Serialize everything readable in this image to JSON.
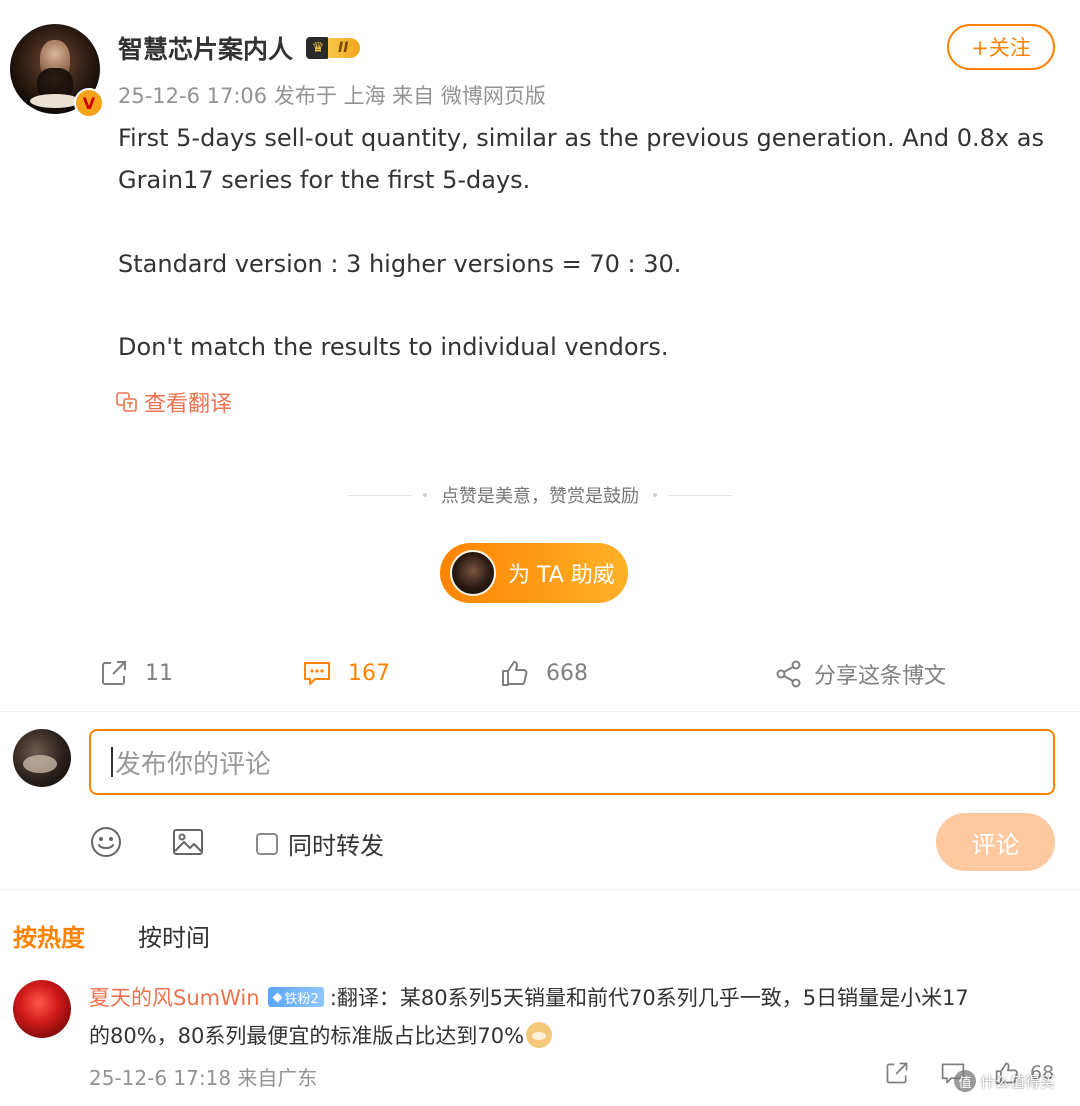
{
  "post": {
    "author": "智慧芯片案内人",
    "level_badge": "II",
    "verified_mark": "V",
    "meta": "25-12-6 17:06 发布于 上海  来自 微博网页版",
    "follow_label": "+关注",
    "lines": [
      "First 5-days sell-out quantity, similar as the previous generation. And  0.8x as",
      "Grain17 series for the first 5-days.",
      "Standard version : 3 higher versions = 70 : 30.",
      "Don't match the results to individual vendors."
    ],
    "translate_label": "查看翻译",
    "reward_text": "点赞是美意，赞赏是鼓励",
    "cheer_label": "为 TA 助威"
  },
  "actions": {
    "repost_count": "11",
    "comment_count": "167",
    "like_count": "668",
    "share_label": "分享这条博文"
  },
  "composer": {
    "placeholder": "发布你的评论",
    "forward_label": "同时转发",
    "submit_label": "评论"
  },
  "sort": {
    "hot": "按热度",
    "time": "按时间"
  },
  "comments": [
    {
      "name": "夏天的风SumWin",
      "badge": "铁粉2",
      "text_line1": ":翻译：某80系列5天销量和前代70系列几乎一致，5日销量是小米17",
      "text_line2": "的80%，80系列最便宜的标准版占比达到70%",
      "meta": "25-12-6 17:18 来自广东",
      "likes": "68"
    }
  ],
  "watermark": {
    "icon": "值",
    "text": "什么值得买"
  },
  "colors": {
    "accent": "#ff8200",
    "link": "#eb7350",
    "meta": "#939393"
  }
}
